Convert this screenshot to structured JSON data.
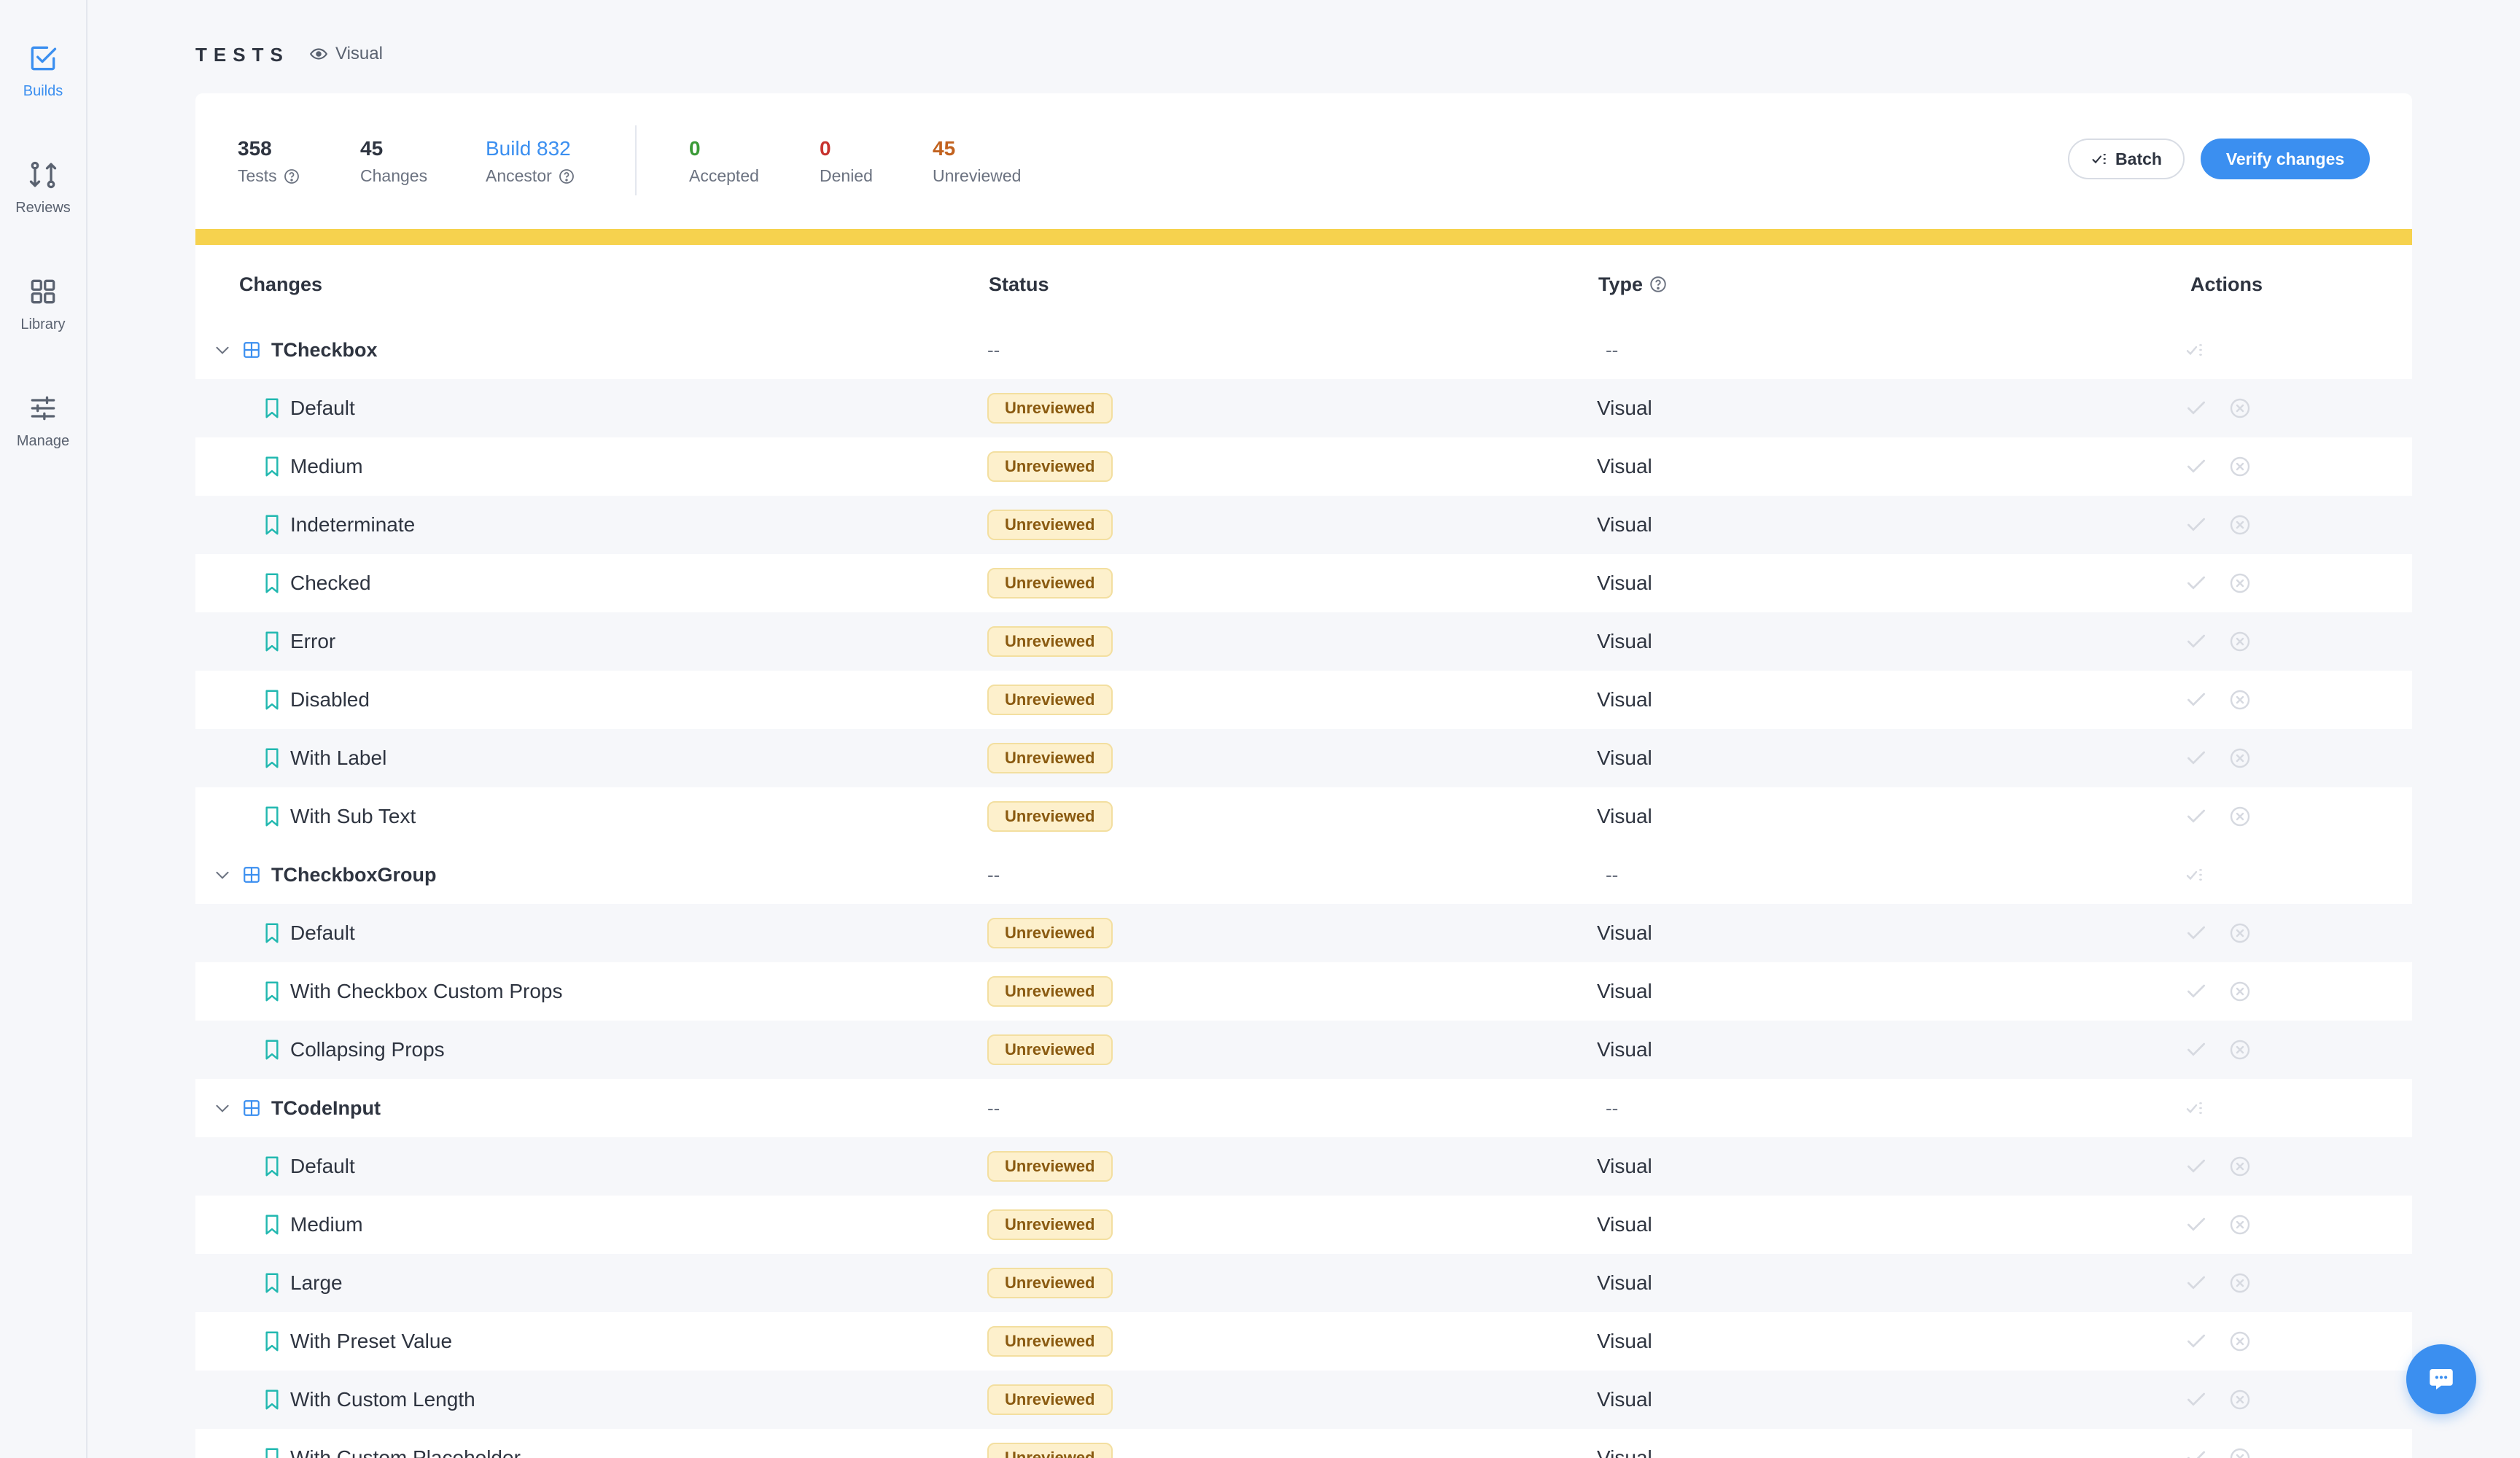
{
  "sidebar": {
    "items": [
      {
        "label": "Builds",
        "icon": "checkbox-check-icon",
        "active": true
      },
      {
        "label": "Reviews",
        "icon": "git-compare-icon",
        "active": false
      },
      {
        "label": "Library",
        "icon": "grid-icon",
        "active": false
      },
      {
        "label": "Manage",
        "icon": "sliders-icon",
        "active": false
      }
    ]
  },
  "header": {
    "title": "TESTS",
    "mode": "Visual"
  },
  "summary": {
    "tests": {
      "value": "358",
      "label": "Tests"
    },
    "changes": {
      "value": "45",
      "label": "Changes"
    },
    "ancestor": {
      "value": "Build 832",
      "label": "Ancestor"
    },
    "accepted": {
      "value": "0",
      "label": "Accepted"
    },
    "denied": {
      "value": "0",
      "label": "Denied"
    },
    "unreviewed": {
      "value": "45",
      "label": "Unreviewed"
    },
    "batch_label": "Batch",
    "verify_label": "Verify changes"
  },
  "colors": {
    "accent": "#3b8ff0",
    "progress": "#f6d24e",
    "accepted": "#3a9a36",
    "denied": "#c8342f",
    "unreviewed": "#c2621f"
  },
  "table": {
    "headers": {
      "changes": "Changes",
      "status": "Status",
      "type": "Type",
      "actions": "Actions"
    },
    "rows": [
      {
        "kind": "group",
        "name": "TCheckbox",
        "status": "--",
        "type": "--"
      },
      {
        "kind": "test",
        "name": "Default",
        "status": "Unreviewed",
        "type": "Visual"
      },
      {
        "kind": "test",
        "name": "Medium",
        "status": "Unreviewed",
        "type": "Visual"
      },
      {
        "kind": "test",
        "name": "Indeterminate",
        "status": "Unreviewed",
        "type": "Visual"
      },
      {
        "kind": "test",
        "name": "Checked",
        "status": "Unreviewed",
        "type": "Visual"
      },
      {
        "kind": "test",
        "name": "Error",
        "status": "Unreviewed",
        "type": "Visual"
      },
      {
        "kind": "test",
        "name": "Disabled",
        "status": "Unreviewed",
        "type": "Visual"
      },
      {
        "kind": "test",
        "name": "With Label",
        "status": "Unreviewed",
        "type": "Visual"
      },
      {
        "kind": "test",
        "name": "With Sub Text",
        "status": "Unreviewed",
        "type": "Visual"
      },
      {
        "kind": "group",
        "name": "TCheckboxGroup",
        "status": "--",
        "type": "--"
      },
      {
        "kind": "test",
        "name": "Default",
        "status": "Unreviewed",
        "type": "Visual"
      },
      {
        "kind": "test",
        "name": "With Checkbox Custom Props",
        "status": "Unreviewed",
        "type": "Visual"
      },
      {
        "kind": "test",
        "name": "Collapsing Props",
        "status": "Unreviewed",
        "type": "Visual"
      },
      {
        "kind": "group",
        "name": "TCodeInput",
        "status": "--",
        "type": "--"
      },
      {
        "kind": "test",
        "name": "Default",
        "status": "Unreviewed",
        "type": "Visual"
      },
      {
        "kind": "test",
        "name": "Medium",
        "status": "Unreviewed",
        "type": "Visual"
      },
      {
        "kind": "test",
        "name": "Large",
        "status": "Unreviewed",
        "type": "Visual"
      },
      {
        "kind": "test",
        "name": "With Preset Value",
        "status": "Unreviewed",
        "type": "Visual"
      },
      {
        "kind": "test",
        "name": "With Custom Length",
        "status": "Unreviewed",
        "type": "Visual"
      },
      {
        "kind": "test",
        "name": "With Custom Placeholder",
        "status": "Unreviewed",
        "type": "Visual"
      }
    ]
  }
}
